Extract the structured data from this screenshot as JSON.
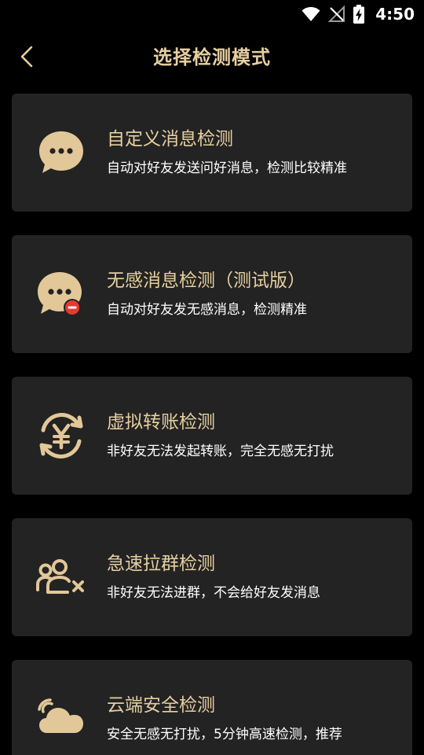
{
  "status_bar": {
    "time": "4:50",
    "icons": [
      "wifi-icon",
      "no-signal-icon",
      "battery-charging-icon"
    ]
  },
  "header": {
    "title": "选择检测模式",
    "back_icon": "back-chevron-icon"
  },
  "colors": {
    "background": "#000000",
    "card": "#232323",
    "accent_gold": "#e6cfa0",
    "icon_gold": "#e2c799",
    "badge_red": "#e8392f"
  },
  "modes": [
    {
      "icon": "chat-bubble-icon",
      "title": "自定义消息检测",
      "desc": "自动对好友发送问好消息，检测比较精准"
    },
    {
      "icon": "chat-bubble-blocked-icon",
      "title": "无感消息检测（测试版）",
      "desc": "自动对好友发无感消息，检测精准"
    },
    {
      "icon": "yuan-transfer-icon",
      "title": "虚拟转账检测",
      "desc": "非好友无法发起转账，完全无感无打扰"
    },
    {
      "icon": "group-remove-icon",
      "title": "急速拉群检测",
      "desc": "非好友无法进群，不会给好友发消息"
    },
    {
      "icon": "cloud-signal-icon",
      "title": "云端安全检测",
      "desc": "安全无感无打扰，5分钟高速检测，推荐"
    }
  ]
}
